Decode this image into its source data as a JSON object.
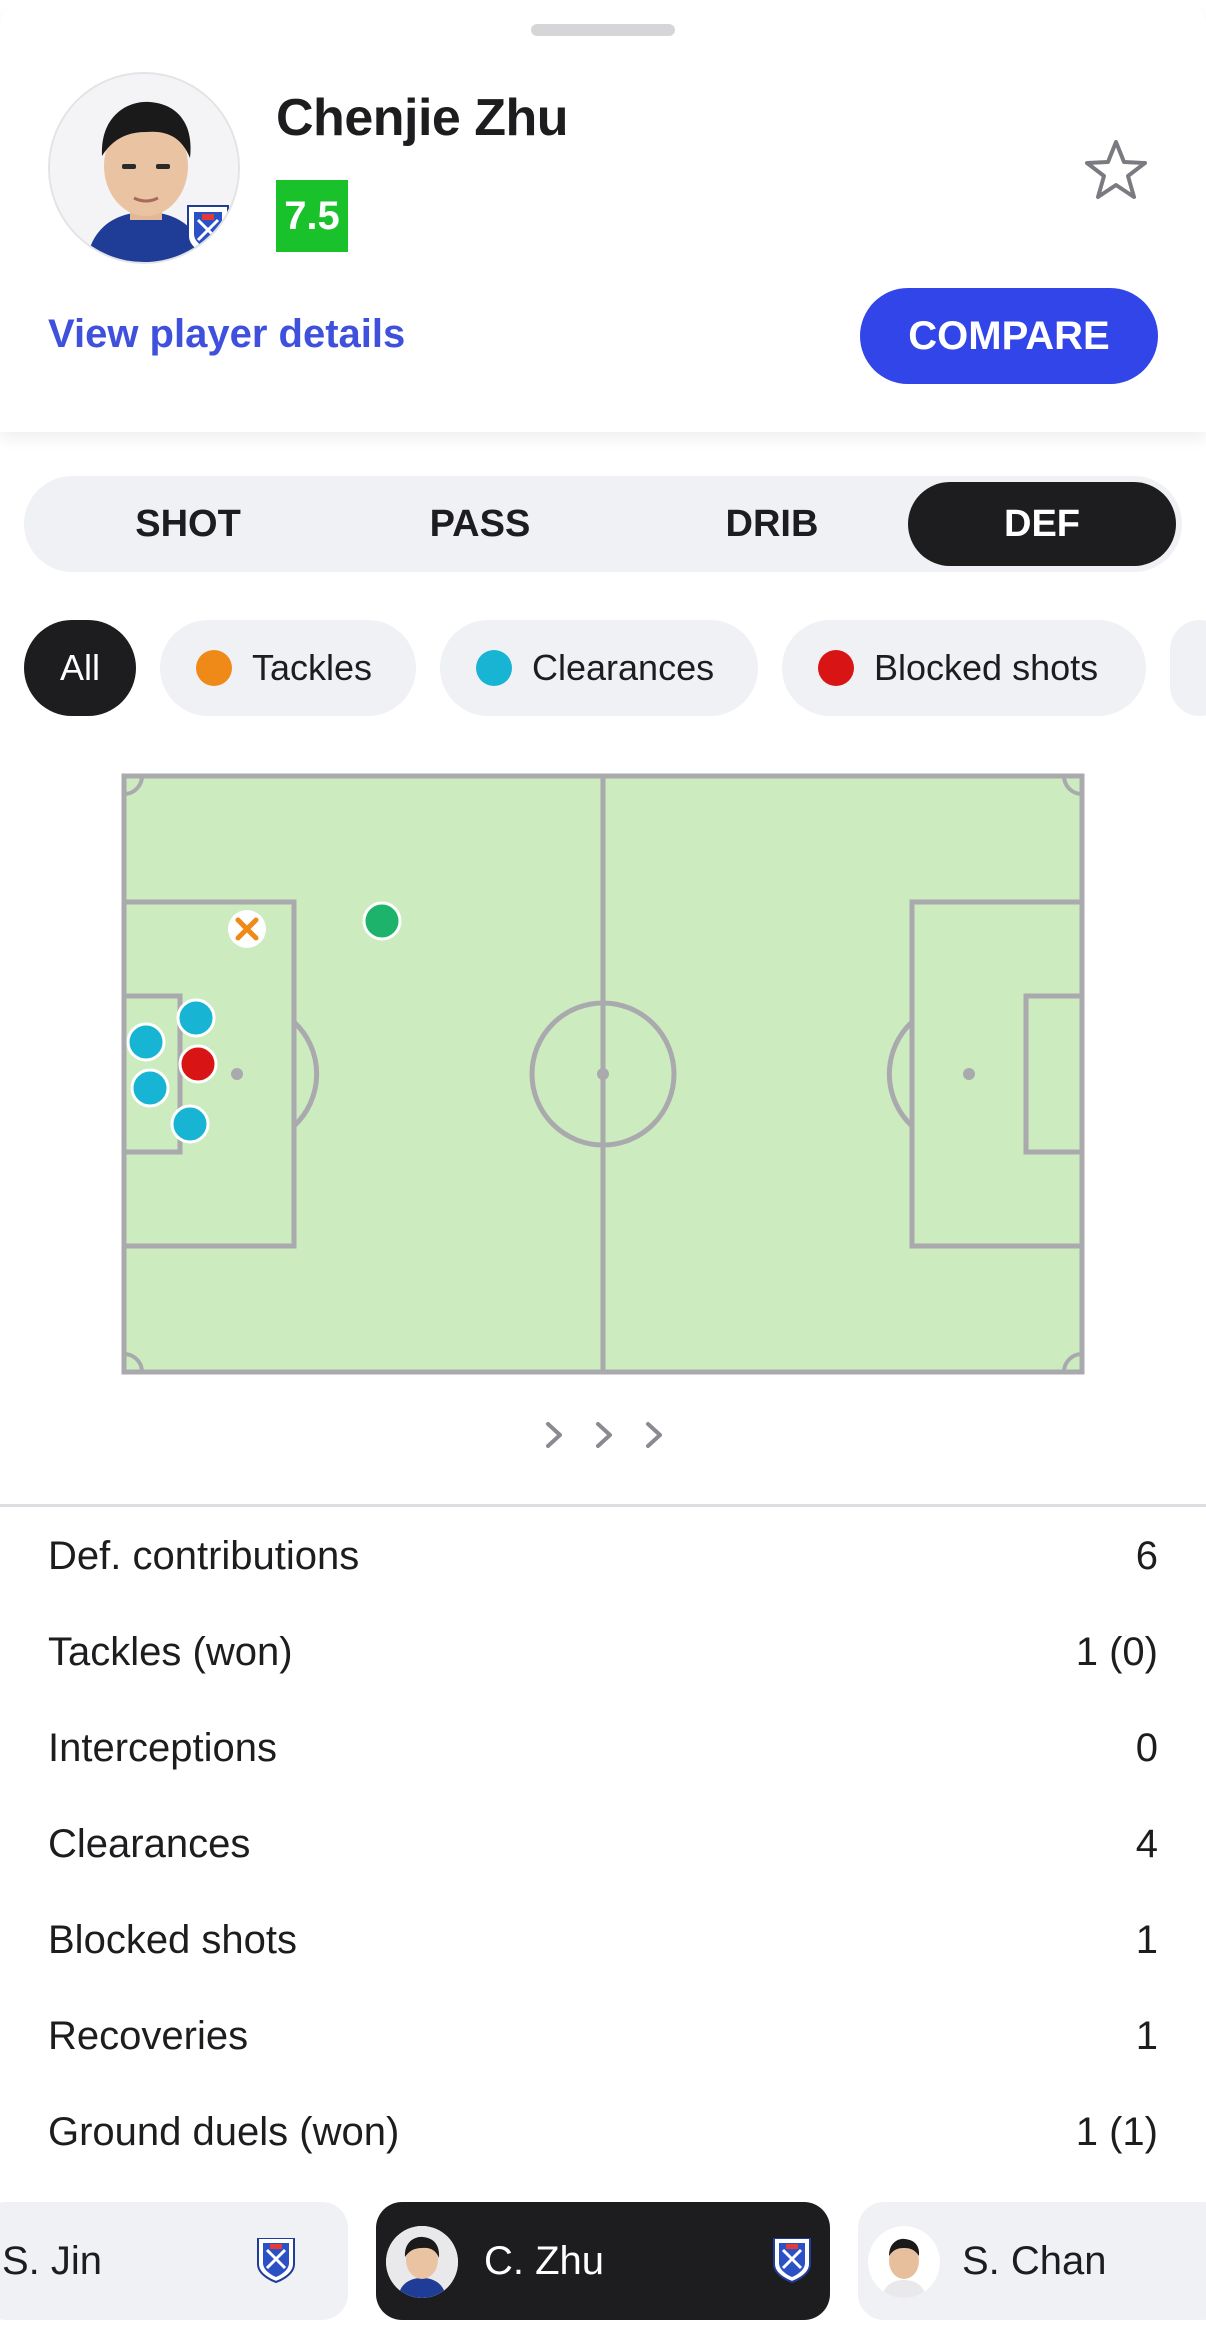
{
  "player": {
    "name": "Chenjie Zhu",
    "rating": "7.5",
    "rating_color": "#19c12a",
    "details_link": "View player details",
    "compare_label": "COMPARE"
  },
  "tabs": [
    {
      "label": "SHOT",
      "active": false
    },
    {
      "label": "PASS",
      "active": false
    },
    {
      "label": "DRIB",
      "active": false
    },
    {
      "label": "DEF",
      "active": true
    }
  ],
  "filters": [
    {
      "label": "All",
      "active": true
    },
    {
      "label": "Tackles",
      "color": "#ef8a19"
    },
    {
      "label": "Clearances",
      "color": "#17b4d3"
    },
    {
      "label": "Blocked shots",
      "color": "#d81414"
    }
  ],
  "pitch_events": [
    {
      "type": "tackle-lost",
      "color": "#ef8a19"
    },
    {
      "type": "recovery",
      "color": "#1db36a"
    },
    {
      "type": "clearance",
      "color": "#17b4d3"
    },
    {
      "type": "clearance",
      "color": "#17b4d3"
    },
    {
      "type": "blocked-shot",
      "color": "#d81414"
    },
    {
      "type": "clearance",
      "color": "#17b4d3"
    },
    {
      "type": "clearance",
      "color": "#17b4d3"
    }
  ],
  "stats": [
    {
      "label": "Def. contributions",
      "value": "6"
    },
    {
      "label": "Tackles (won)",
      "value": "1 (0)"
    },
    {
      "label": "Interceptions",
      "value": "0"
    },
    {
      "label": "Clearances",
      "value": "4"
    },
    {
      "label": "Blocked shots",
      "value": "1"
    },
    {
      "label": "Recoveries",
      "value": "1"
    },
    {
      "label": "Ground duels (won)",
      "value": "1 (1)"
    }
  ],
  "player_switcher": [
    {
      "name": "S. Jin",
      "active": false
    },
    {
      "name": "C. Zhu",
      "active": true
    },
    {
      "name": "S. Chan",
      "active": false
    }
  ],
  "colors": {
    "accent": "#3145e8",
    "link": "#3e50dc",
    "pitch": "#ccecc0",
    "pitch_lines": "#a9a9ae"
  }
}
